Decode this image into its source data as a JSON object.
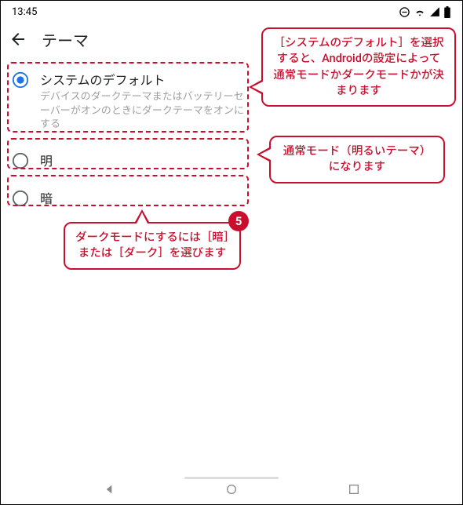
{
  "status": {
    "time": "13:45"
  },
  "appbar": {
    "title": "テーマ"
  },
  "options": {
    "system": {
      "label": "システムのデフォルト",
      "sub": "デバイスのダークテーマまたはバッテリーセーバーがオンのときにダークテーマをオンにする",
      "selected": true
    },
    "light": {
      "label": "明",
      "selected": false
    },
    "dark": {
      "label": "暗",
      "selected": false
    }
  },
  "callouts": {
    "c1": "［システムのデフォルト］を選択すると、Androidの設定によって通常モードかダークモードかが決まります",
    "c2": "通常モード（明るいテーマ）になります",
    "c3": "ダークモードにするには［暗］または［ダーク］を選びます"
  },
  "step_badge": "5",
  "colors": {
    "accent": "#1a73e8",
    "annotation": "#c8102e"
  }
}
